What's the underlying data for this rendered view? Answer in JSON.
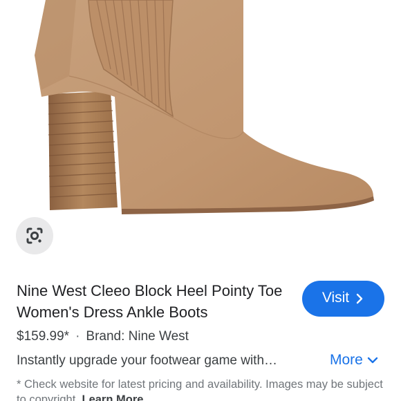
{
  "product": {
    "image_alt": "Tan suede block heel pointy toe ankle boot",
    "title": "Nine West Cleeo Block Heel Pointy Toe Women's Dress Ankle Boots",
    "price": "$159.99*",
    "separator": "·",
    "brand": "Brand: Nine West",
    "description": "Instantly upgrade your footwear game with…"
  },
  "actions": {
    "visit_label": "Visit",
    "more_label": "More",
    "lens_icon": "google-lens-icon"
  },
  "disclaimer": {
    "text": "* Check website for latest pricing and availability. Images may be subject to copyright.",
    "link_label": "Learn More"
  },
  "colors": {
    "accent": "#1a73e8",
    "suede": "#c49a74",
    "heel_wood": "#a67a52",
    "lens_bg": "#e9e9ea"
  }
}
